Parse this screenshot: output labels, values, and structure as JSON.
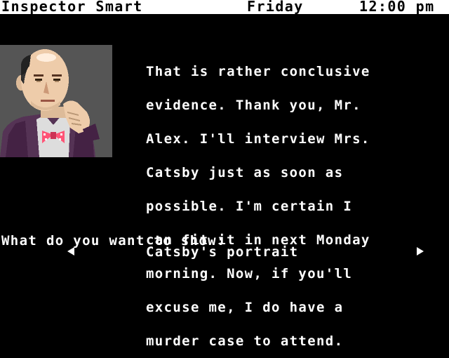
{
  "status_bar": {
    "character_name": "Inspector Smart",
    "day": "Friday",
    "time": "12:00 pm"
  },
  "portrait": {
    "icon": "inspector-smart-portrait",
    "colors": {
      "background": "#555555",
      "skin": "#eeccaa",
      "suit": "#553355",
      "bowtie": "#ff5577"
    }
  },
  "dialogue": {
    "lines": [
      "That is rather conclusive",
      "evidence. Thank you, Mr.",
      "Alex. I'll interview Mrs.",
      "Catsby just as soon as",
      "possible. I'm certain I",
      "can fit it in next Monday",
      "morning. Now, if you'll",
      "excuse me, I do have a",
      "murder case to attend."
    ]
  },
  "prompt": {
    "label": "What do you want to show:",
    "selected_item": "Catsby's portrait",
    "prev_icon": "arrow-left-icon",
    "next_icon": "arrow-right-icon"
  }
}
